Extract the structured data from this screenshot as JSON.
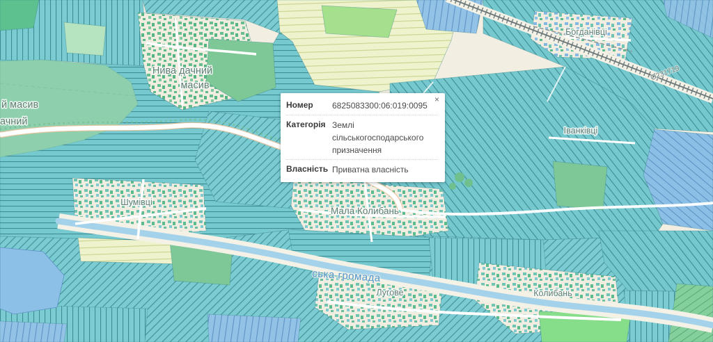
{
  "popup": {
    "close": "×",
    "rows": [
      {
        "label": "Номер",
        "value": "6825083300:06:019:0095"
      },
      {
        "label": "Категорія",
        "value": "Землі сільськогосподарського призначення"
      },
      {
        "label": "Власність",
        "value": "Приватна власність"
      }
    ]
  },
  "map": {
    "labels": {
      "niva_line1": "Нива дачний",
      "niva_line2": "масив",
      "edge_line1": "й масив",
      "edge_line2": "ачний",
      "shumivtsi": "Шумівці",
      "mala_kolyban": "Мала Колибань",
      "bohdanivtsi": "Богданівці",
      "ivankivtsi": "Іванківці",
      "luhove": "Лугове",
      "kolyban": "Колибань",
      "hromada": "ська громада",
      "road_code": "О231719"
    },
    "colors": {
      "background": "#f2eee2",
      "parcel_teal": "#7accd2",
      "parcel_teal_line": "#3e8d93",
      "parcel_blue": "#8fc0e6",
      "forest_green": "#7ec897",
      "massif_green": "#8ecfae",
      "field_yellow": "#eff3cd",
      "bright_green": "#a5e18c",
      "river_blue": "#a4d2ea",
      "road_white": "#ffffff",
      "label_green": "#5f7f74",
      "label_blue": "#4f96cc",
      "popup_bg": "#ffffff"
    }
  }
}
